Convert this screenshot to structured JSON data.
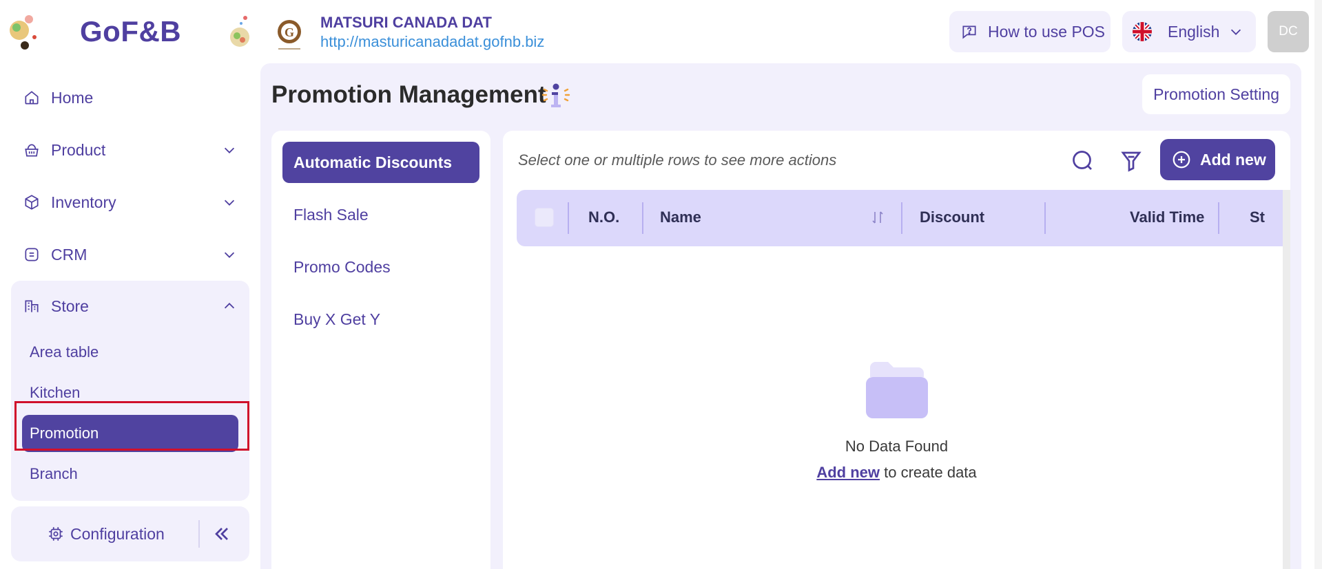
{
  "brand": {
    "logo_text": "GoF&B"
  },
  "store": {
    "name": "MATSURI CANADA DAT",
    "url": "http://masturicanadadat.gofnb.biz"
  },
  "header": {
    "howto_label": "How to use POS",
    "language_label": "English",
    "avatar_initials": "DC"
  },
  "sidebar": {
    "items": [
      {
        "label": "Home"
      },
      {
        "label": "Product"
      },
      {
        "label": "Inventory"
      },
      {
        "label": "CRM"
      },
      {
        "label": "Store"
      }
    ],
    "store_subitems": [
      {
        "label": "Area table"
      },
      {
        "label": "Kitchen"
      },
      {
        "label": "Promotion"
      },
      {
        "label": "Branch"
      }
    ],
    "configuration_label": "Configuration"
  },
  "page": {
    "title": "Promotion Management",
    "setting_button": "Promotion Setting"
  },
  "tabs": [
    {
      "label": "Automatic Discounts"
    },
    {
      "label": "Flash Sale"
    },
    {
      "label": "Promo Codes"
    },
    {
      "label": "Buy X Get Y"
    }
  ],
  "toolbar": {
    "hint": "Select one or multiple rows to see more actions",
    "add_new_label": "Add new"
  },
  "table": {
    "columns": [
      "N.O.",
      "Name",
      "Discount",
      "Valid Time",
      "St"
    ]
  },
  "empty_state": {
    "title": "No Data Found",
    "link": "Add new",
    "suffix": " to create data"
  },
  "colors": {
    "primary": "#5043a0",
    "primary_light": "#f2f0fc",
    "table_header": "#dcd8fb",
    "highlight_outline": "#d0102b",
    "link_blue": "#3a8fd9"
  }
}
